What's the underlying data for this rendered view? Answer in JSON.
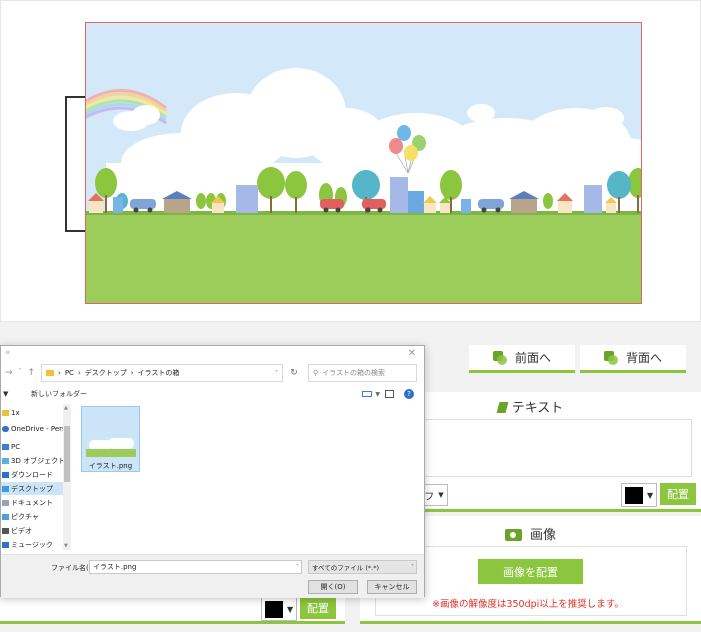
{
  "toolbar": {
    "front_label": "前面へ",
    "back_label": "背面へ"
  },
  "text_section": {
    "title": "テキスト",
    "align_partial": "フ",
    "place_label": "配置"
  },
  "image_section": {
    "title": "画像",
    "place_button": "画像を配置",
    "note": "※画像の解像度は350dpi以上を推奨します。"
  },
  "left_bottom": {
    "place_label": "配置"
  },
  "dialog": {
    "breadcrumb": [
      "PC",
      "デスクトップ",
      "イラストの箱"
    ],
    "search_placeholder": "イラストの箱の検索",
    "organize": "▼",
    "new_folder": "新しいフォルダー",
    "tree": [
      "1x",
      "OneDrive - Person",
      "PC",
      "3D オブジェクト",
      "ダウンロード",
      "デスクトップ",
      "ドキュメント",
      "ピクチャ",
      "ビデオ",
      "ミュージック"
    ],
    "file": "イラスト.png",
    "filename_label": "ファイル名(N):",
    "filename_value": "イラスト.png",
    "filetype": "すべてのファイル (*.*)",
    "open_button": "開く(O)",
    "cancel_button": "キャンセル"
  },
  "colors": {
    "accent": "#8cc63f",
    "canvas_border": "#e06666",
    "note_red": "#e0312b"
  }
}
